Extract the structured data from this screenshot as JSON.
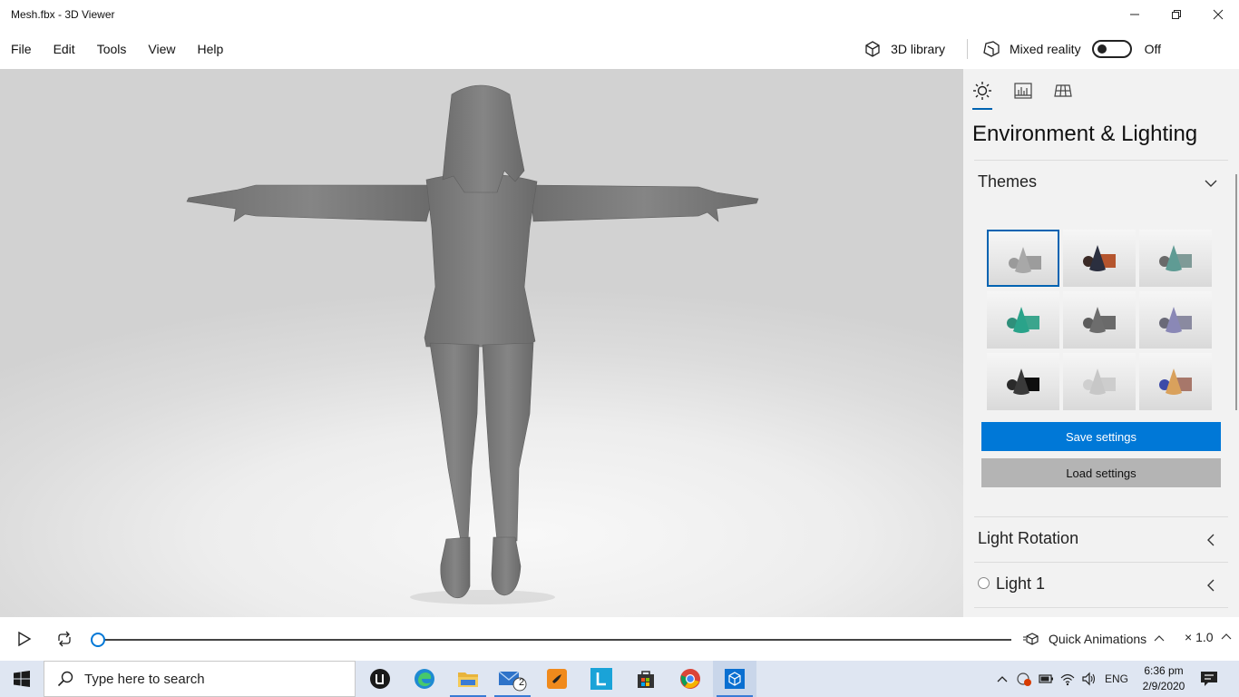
{
  "window": {
    "title": "Mesh.fbx - 3D Viewer"
  },
  "menu": {
    "items": [
      "File",
      "Edit",
      "Tools",
      "View",
      "Help"
    ]
  },
  "toolbar": {
    "library_label": "3D library",
    "mixed_reality_label": "Mixed reality",
    "mixed_reality_state": "Off"
  },
  "panel": {
    "title": "Environment & Lighting",
    "themes_label": "Themes",
    "save_label": "Save settings",
    "load_label": "Load settings",
    "light_rotation_label": "Light Rotation",
    "light1_label": "Light 1"
  },
  "themes": [
    {
      "sphere": "#9a9a9a",
      "cone": "#a8a8a8",
      "box": "#9c9c9c",
      "selected": true
    },
    {
      "sphere": "#3a2a26",
      "cone": "#2b2f3f",
      "box": "#b5552e",
      "selected": false
    },
    {
      "sphere": "#6a6a6a",
      "cone": "#5f9b94",
      "box": "#7f9a97",
      "selected": false
    },
    {
      "sphere": "#2f8f7a",
      "cone": "#2aa38a",
      "box": "#3ba58d",
      "selected": false
    },
    {
      "sphere": "#5c5c5c",
      "cone": "#6d6d6d",
      "box": "#6a6a6a",
      "selected": false
    },
    {
      "sphere": "#6a6a78",
      "cone": "#8a88b6",
      "box": "#8a8aa0",
      "selected": false
    },
    {
      "sphere": "#2a2a2a",
      "cone": "#3a3a3a",
      "box": "#0e0e0e",
      "selected": false
    },
    {
      "sphere": "#cfcfcf",
      "cone": "#c7c7c7",
      "box": "#cdcdcd",
      "selected": false
    },
    {
      "sphere": "#3d4aa8",
      "cone": "#d9a15c",
      "box": "#a7776a",
      "selected": false
    }
  ],
  "animation": {
    "quick_animations_label": "Quick Animations",
    "speed_label": "× 1.0",
    "progress": 0
  },
  "taskbar": {
    "search_placeholder": "Type here to search",
    "language": "ENG",
    "time": "6:36 pm",
    "date": "2/9/2020",
    "mail_badge": "2"
  },
  "colors": {
    "accent": "#0078d7",
    "model": "#7f7f7f"
  }
}
